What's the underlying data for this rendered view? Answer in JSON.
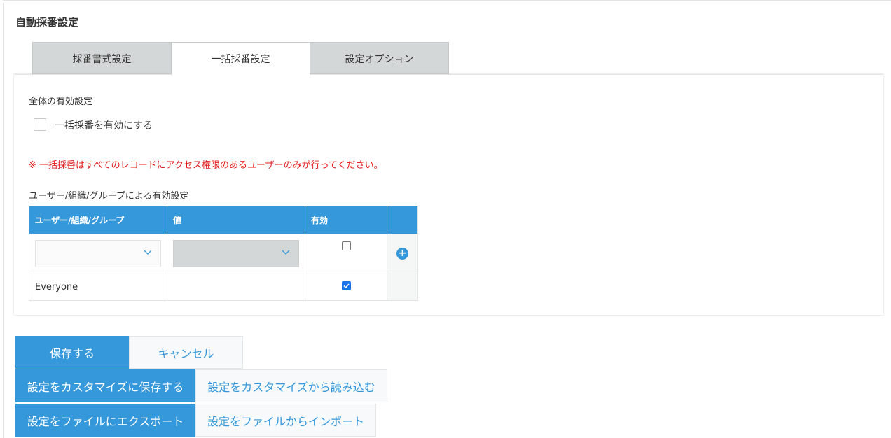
{
  "page": {
    "title": "自動採番設定"
  },
  "tabs": [
    {
      "label": "採番書式設定",
      "active": false
    },
    {
      "label": "一括採番設定",
      "active": true
    },
    {
      "label": "設定オプション",
      "active": false
    }
  ],
  "global_setting": {
    "heading": "全体の有効設定",
    "checkbox_label": "一括採番を有効にする",
    "checked": false
  },
  "warning": "※ 一括採番はすべてのレコードにアクセス権限のあるユーザーのみが行ってください。",
  "user_setting": {
    "heading": "ユーザー/組織/グループによる有効設定",
    "columns": [
      "ユーザー/組織/グループ",
      "値",
      "有効",
      ""
    ],
    "new_row": {
      "entity": "",
      "value": "",
      "enabled": false
    },
    "rows": [
      {
        "entity": "Everyone",
        "value": "",
        "enabled": true
      }
    ]
  },
  "buttons": {
    "save": "保存する",
    "cancel": "キャンセル",
    "save_customize": "設定をカスタマイズに保存する",
    "load_customize": "設定をカスタマイズから読み込む",
    "export_file": "設定をファイルにエクスポート",
    "import_file": "設定をファイルからインポート"
  },
  "colors": {
    "accent": "#3498db",
    "warning": "#e11e1e",
    "tab_inactive": "#d4d7d7"
  }
}
